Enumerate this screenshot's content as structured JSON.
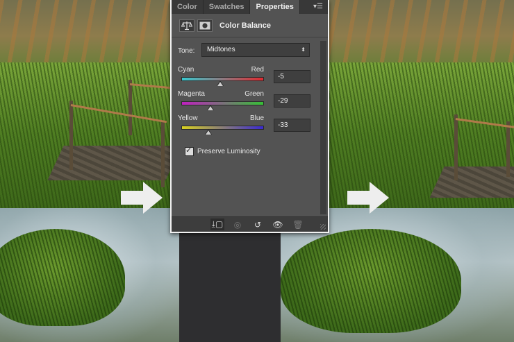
{
  "tabs": [
    {
      "label": "Color",
      "active": false
    },
    {
      "label": "Swatches",
      "active": false
    },
    {
      "label": "Properties",
      "active": true
    }
  ],
  "panel_menu_icon": "panel-menu-icon",
  "header": {
    "title": "Color Balance",
    "adjustment_icon": "balance-scale-icon",
    "mask_icon": "layer-mask-icon"
  },
  "tone": {
    "label": "Tone:",
    "value": "Midtones"
  },
  "sliders": [
    {
      "left": "Cyan",
      "right": "Red",
      "value": "-5",
      "level": -5,
      "colors": [
        "#39c9d0",
        "#e02a30"
      ]
    },
    {
      "left": "Magenta",
      "right": "Green",
      "value": "-29",
      "level": -29,
      "colors": [
        "#c020c0",
        "#36c036"
      ]
    },
    {
      "left": "Yellow",
      "right": "Blue",
      "value": "-33",
      "level": -33,
      "colors": [
        "#d8d020",
        "#3a2ad0"
      ]
    }
  ],
  "preserve_luminosity": {
    "label": "Preserve Luminosity",
    "checked": true
  },
  "footer_icons": [
    "clip-to-layer-icon",
    "view-previous-state-icon",
    "reset-icon",
    "visibility-eye-icon",
    "delete-icon"
  ]
}
